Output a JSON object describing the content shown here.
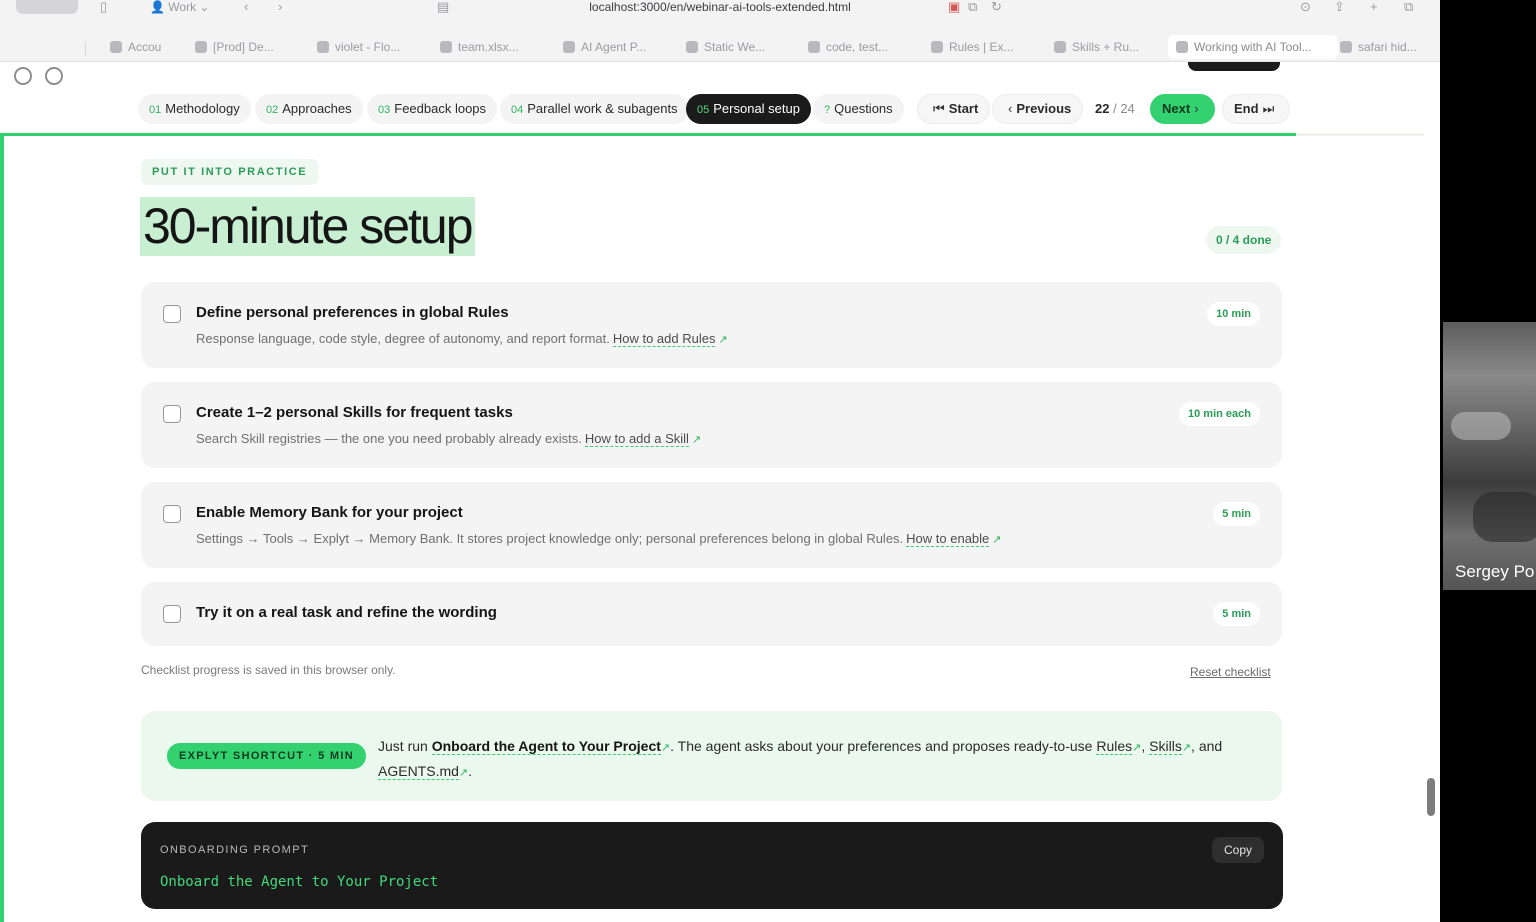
{
  "browser": {
    "profile": "Work",
    "url": "localhost:3000/en/webinar-ai-tools-extended.html",
    "tabs": [
      {
        "label": "Accou"
      },
      {
        "label": "[Prod] De..."
      },
      {
        "label": "violet - Flo..."
      },
      {
        "label": "team.xlsx..."
      },
      {
        "label": "AI Agent P..."
      },
      {
        "label": "Static We..."
      },
      {
        "label": "code, test..."
      },
      {
        "label": "Rules | Ex..."
      },
      {
        "label": "Skills + Ru..."
      },
      {
        "label": "Working with AI Tool..."
      },
      {
        "label": "safari hid..."
      }
    ]
  },
  "nav": {
    "sections": [
      {
        "num": "01",
        "label": "Methodology"
      },
      {
        "num": "02",
        "label": "Approaches"
      },
      {
        "num": "03",
        "label": "Feedback loops"
      },
      {
        "num": "04",
        "label": "Parallel work & subagents"
      },
      {
        "num": "05",
        "label": "Personal setup"
      },
      {
        "num": "?",
        "label": "Questions"
      }
    ],
    "active_index": 4,
    "start": "Start",
    "previous": "Previous",
    "current": "22",
    "total": "/ 24",
    "next": "Next",
    "end": "End",
    "progress_fraction": 0.91
  },
  "main": {
    "eyebrow": "PUT IT INTO PRACTICE",
    "title": "30-minute setup",
    "done_badge": "0 / 4 done",
    "checklist": [
      {
        "title": "Define personal preferences in global Rules",
        "desc": "Response language, code style, degree of autonomy, and report format.",
        "link": "How to add Rules",
        "time": "10 min",
        "checked": false
      },
      {
        "title": "Create 1–2 personal Skills for frequent tasks",
        "desc": "Search Skill registries — the one you need probably already exists.",
        "link": "How to add a Skill",
        "time": "10 min each",
        "checked": false
      },
      {
        "title": "Enable Memory Bank for your project",
        "desc": "Settings → Tools → Explyt → Memory Bank. It stores project knowledge only; personal preferences belong in global Rules.",
        "link": "How to enable",
        "time": "5 min",
        "checked": false
      },
      {
        "title": "Try it on a real task and refine the wording",
        "desc": "",
        "link": "",
        "time": "5 min",
        "checked": false
      }
    ],
    "note": "Checklist progress is saved in this browser only.",
    "reset": "Reset checklist",
    "shortcut": {
      "badge": "EXPLYT SHORTCUT · 5 MIN",
      "t1": "Just run",
      "link1": "Onboard the Agent to Your Project",
      "t2": ". The agent asks about your preferences and proposes ready-to-use",
      "link2": "Rules",
      "t3": ",",
      "link3": "Skills",
      "t4": ", and",
      "link4": "AGENTS.md",
      "t5": "."
    },
    "prompt": {
      "label": "ONBOARDING PROMPT",
      "code": "Onboard the Agent to Your Project",
      "copy": "Copy"
    }
  },
  "video": {
    "participant": "Sergey Po"
  },
  "icons": {
    "arrow": "↗"
  }
}
